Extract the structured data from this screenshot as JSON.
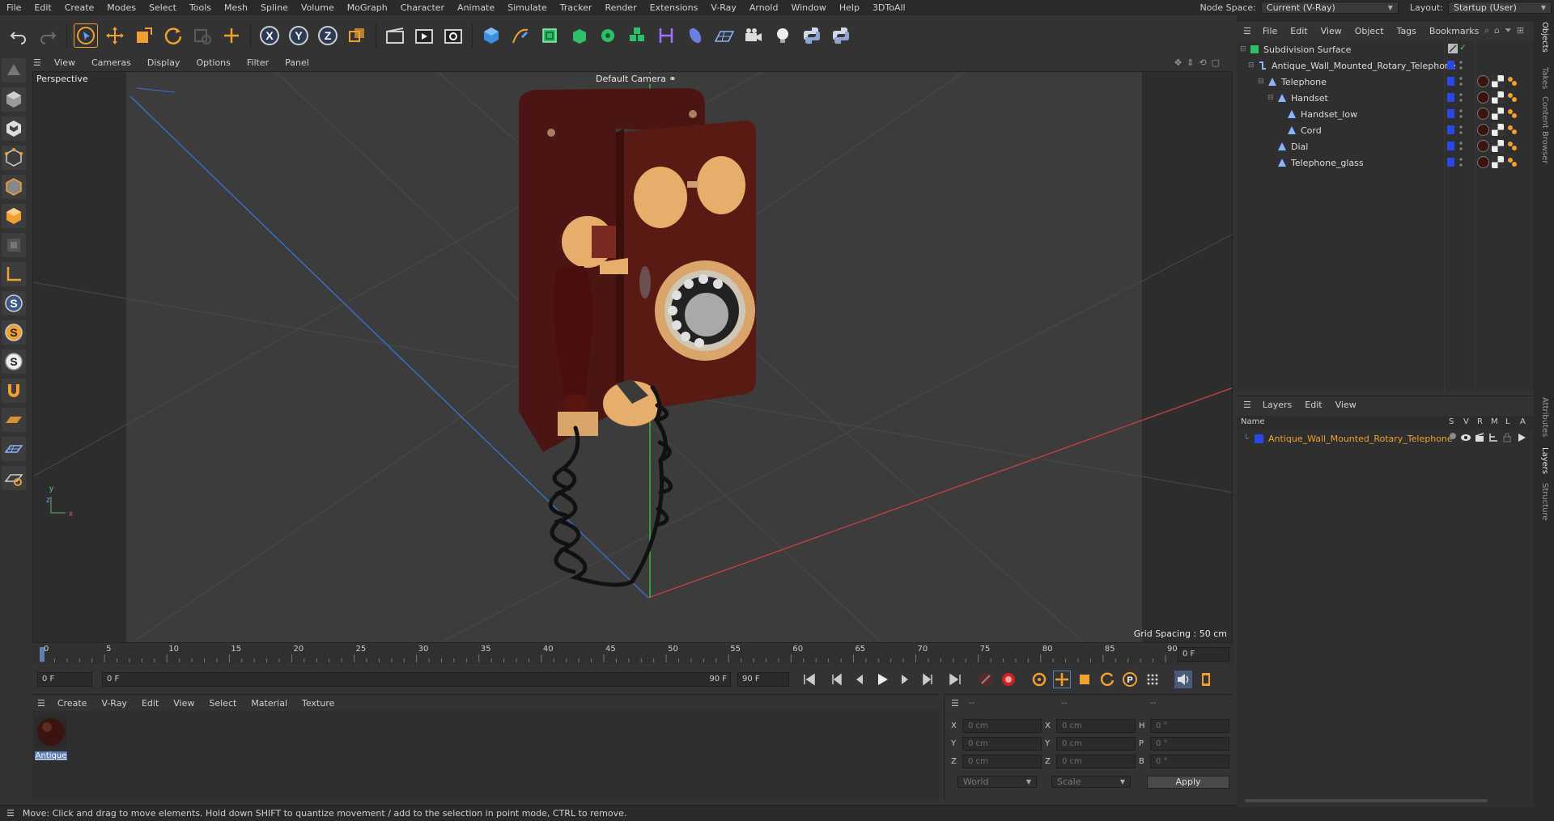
{
  "menubar": {
    "items": [
      "File",
      "Edit",
      "Create",
      "Modes",
      "Select",
      "Tools",
      "Mesh",
      "Spline",
      "Volume",
      "MoGraph",
      "Character",
      "Animate",
      "Simulate",
      "Tracker",
      "Render",
      "Extensions",
      "V-Ray",
      "Arnold",
      "Window",
      "Help",
      "3DToAll"
    ],
    "node_space_label": "Node Space:",
    "node_space_value": "Current (V-Ray)",
    "layout_label": "Layout:",
    "layout_value": "Startup (User)"
  },
  "viewport": {
    "menu": [
      "View",
      "Cameras",
      "Display",
      "Options",
      "Filter",
      "Panel"
    ],
    "name": "Perspective",
    "camera": "Default Camera",
    "grid_spacing": "Grid Spacing : 50 cm"
  },
  "timeline": {
    "ticks": [
      "0",
      "5",
      "10",
      "15",
      "20",
      "25",
      "30",
      "35",
      "40",
      "45",
      "50",
      "55",
      "60",
      "65",
      "70",
      "75",
      "80",
      "85",
      "90"
    ],
    "current_frame": "0 F",
    "start_field": "0 F",
    "range_start": "0 F",
    "range_end": "90 F",
    "end_field": "90 F"
  },
  "material_manager": {
    "menu": [
      "Create",
      "V-Ray",
      "Edit",
      "View",
      "Select",
      "Material",
      "Texture"
    ],
    "materials": [
      {
        "name": "Antique"
      }
    ]
  },
  "coordinates": {
    "headers": [
      "--",
      "--",
      "--"
    ],
    "rows": [
      {
        "a": "X",
        "av": "0 cm",
        "b": "X",
        "bv": "0 cm",
        "c": "H",
        "cv": "0 °"
      },
      {
        "a": "Y",
        "av": "0 cm",
        "b": "Y",
        "bv": "0 cm",
        "c": "P",
        "cv": "0 °"
      },
      {
        "a": "Z",
        "av": "0 cm",
        "b": "Z",
        "bv": "0 cm",
        "c": "B",
        "cv": "0 °"
      }
    ],
    "mode": "World",
    "transform": "Scale",
    "apply": "Apply"
  },
  "object_manager": {
    "menu": [
      "File",
      "Edit",
      "View",
      "Object",
      "Tags",
      "Bookmarks"
    ],
    "objects": [
      {
        "name": "Subdivision Surface",
        "indent": 0
      },
      {
        "name": "Antique_Wall_Mounted_Rotary_Telephone",
        "indent": 1
      },
      {
        "name": "Telephone",
        "indent": 2
      },
      {
        "name": "Handset",
        "indent": 3
      },
      {
        "name": "Handset_low",
        "indent": 4
      },
      {
        "name": "Cord",
        "indent": 4
      },
      {
        "name": "Dial",
        "indent": 3
      },
      {
        "name": "Telephone_glass",
        "indent": 3
      }
    ]
  },
  "layers": {
    "menu": [
      "Layers",
      "Edit",
      "View"
    ],
    "header_name": "Name",
    "header_flags": [
      "S",
      "V",
      "R",
      "M",
      "L",
      "A"
    ],
    "items": [
      {
        "name": "Antique_Wall_Mounted_Rotary_Telephone"
      }
    ]
  },
  "side_tabs": [
    "Objects",
    "Takes",
    "Content Browser",
    "Attributes",
    "Layers",
    "Structure"
  ],
  "status": "Move: Click and drag to move elements. Hold down SHIFT to quantize movement / add to the selection in point mode, CTRL to remove.",
  "colors": {
    "accent": "#f0a030",
    "layer_blue": "#2a47e8",
    "selection": "#5b7fb5"
  }
}
